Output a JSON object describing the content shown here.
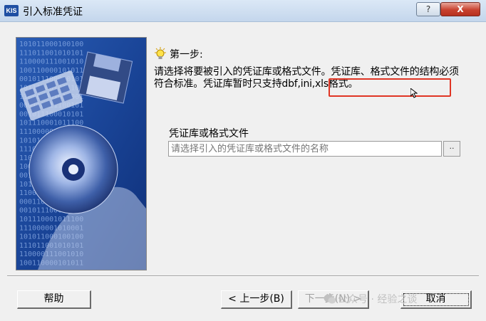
{
  "window": {
    "app_icon_text": "KIS",
    "title": "引入标准凭证",
    "help_label": "?",
    "close_label": "X"
  },
  "step": {
    "title": "第一步:",
    "description": "请选择将要被引入的凭证库或格式文件。凭证库、格式文件的结构必须符合标准。凭证库暂时只支持dbf,ini,xls格式。"
  },
  "file_field": {
    "label": "凭证库或格式文件",
    "value": "",
    "placeholder": "请选择引入的凭证库或格式文件的名称",
    "browse_label": ".."
  },
  "side_image": {
    "binary_lines": [
      "101011000100100",
      "111011001010101",
      "110000111001010",
      "100110000101011",
      "001011100010101",
      "101110001011100",
      "110000001010001",
      "000110111100101",
      "001011100010101",
      "101110001011100",
      "111000001010001"
    ]
  },
  "buttons": {
    "help": "帮助",
    "prev": "< 上一步(B)",
    "next": "下一步(N) >",
    "cancel": "取消"
  },
  "watermark": "公众号 · 经验之谈",
  "colors": {
    "highlight_box": "#e03524",
    "title_gradient_top": "#dbe8f6",
    "image_blue": "#1e4ea0"
  }
}
